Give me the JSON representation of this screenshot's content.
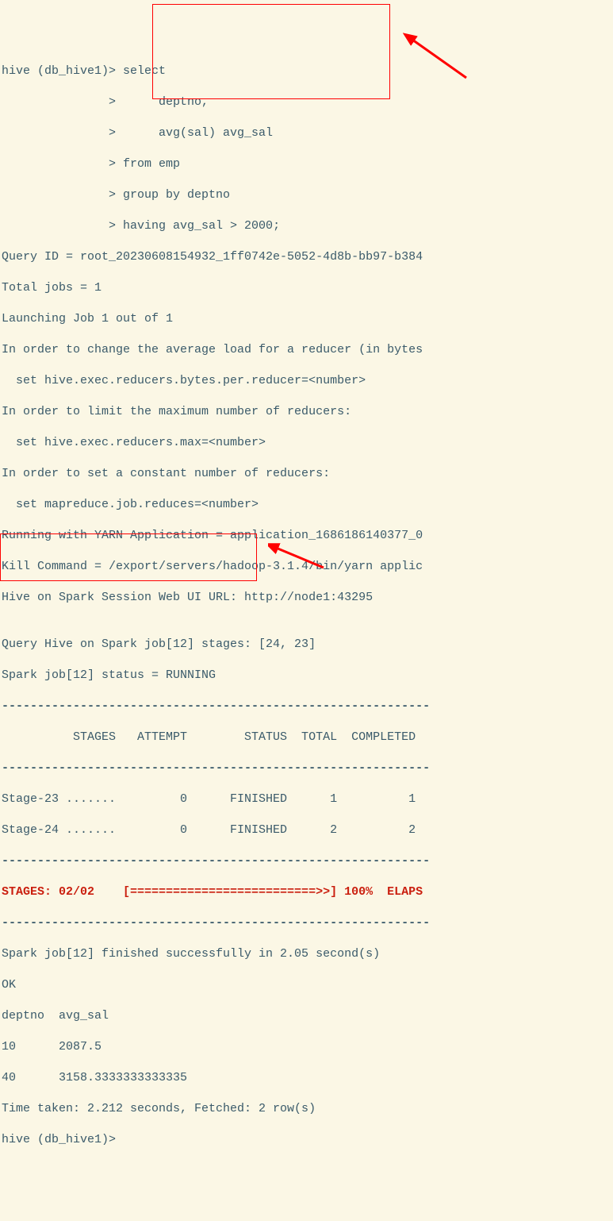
{
  "terminal": {
    "prompt": "hive (db_hive1)>",
    "continuation": "               >",
    "sql": {
      "line1": " select",
      "line2": "      deptno,",
      "line3": "      avg(sal) avg_sal",
      "line4": " from emp",
      "line5": " group by deptno",
      "line6": " having avg_sal > 2000;"
    },
    "output": {
      "query_id": "Query ID = root_20230608154932_1ff0742e-5052-4d8b-bb97-b384",
      "total_jobs": "Total jobs = 1",
      "launching": "Launching Job 1 out of 1",
      "reducer_msg1": "In order to change the average load for a reducer (in bytes",
      "reducer_set1": "  set hive.exec.reducers.bytes.per.reducer=<number>",
      "reducer_msg2": "In order to limit the maximum number of reducers:",
      "reducer_set2": "  set hive.exec.reducers.max=<number>",
      "reducer_msg3": "In order to set a constant number of reducers:",
      "reducer_set3": "  set mapreduce.job.reduces=<number>",
      "yarn_app": "Running with YARN Application = application_1686186140377_0",
      "kill_cmd": "Kill Command = /export/servers/hadoop-3.1.4/bin/yarn applic",
      "web_ui": "Hive on Spark Session Web UI URL: http://node1:43295",
      "blank1": "",
      "query_stages": "Query Hive on Spark job[12] stages: [24, 23]",
      "job_status": "Spark job[12] status = RUNNING",
      "dashes1": "------------------------------------------------------------",
      "table_header": "          STAGES   ATTEMPT        STATUS  TOTAL  COMPLETED  ",
      "dashes2": "------------------------------------------------------------",
      "stage23": "Stage-23 .......         0      FINISHED      1          1  ",
      "stage24": "Stage-24 .......         0      FINISHED      2          2  ",
      "dashes3": "------------------------------------------------------------",
      "progress": "STAGES: 02/02    [==========================>>] 100%  ELAPS",
      "dashes4": "------------------------------------------------------------",
      "job_finished": "Spark job[12] finished successfully in 2.05 second(s)",
      "ok": "OK",
      "result_header": "deptno  avg_sal",
      "result_row1": "10      2087.5",
      "result_row2": "40      3158.3333333333335",
      "time_taken": "Time taken: 2.212 seconds, Fetched: 2 row(s)",
      "prompt_end": "hive (db_hive1)>"
    }
  }
}
